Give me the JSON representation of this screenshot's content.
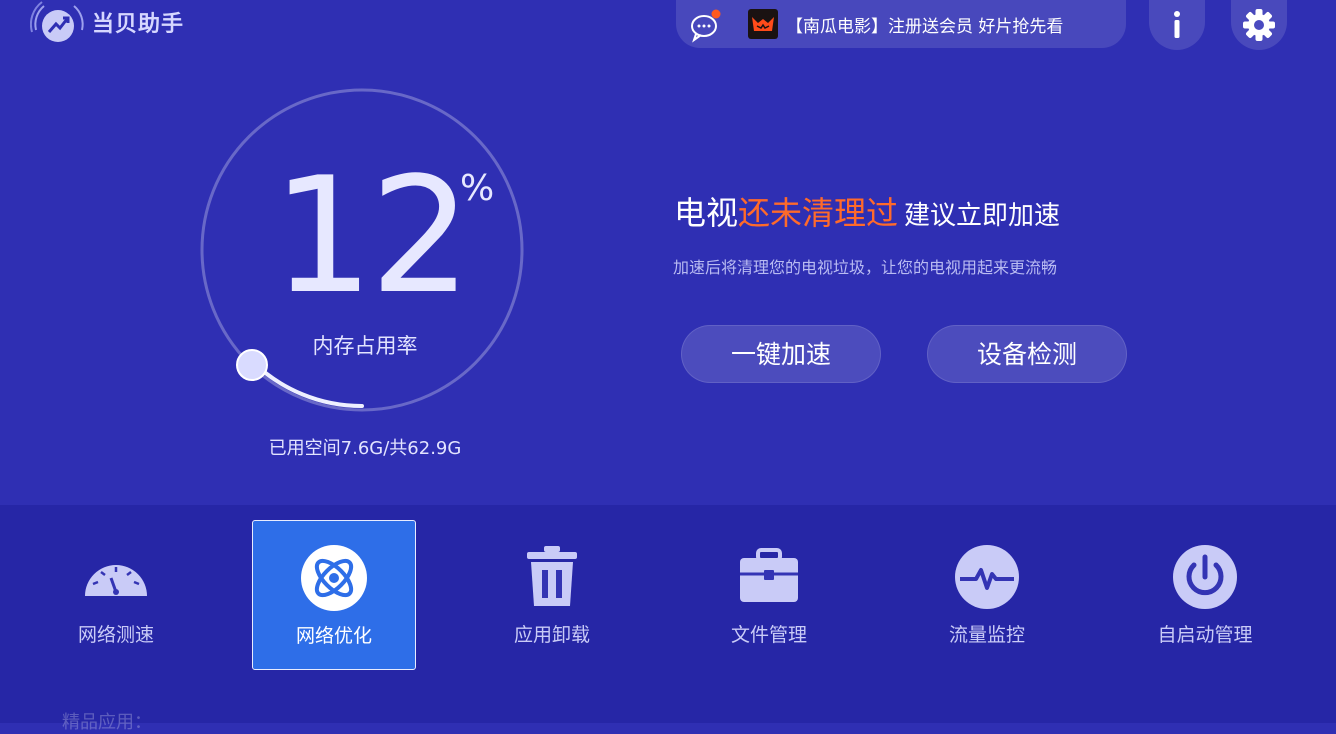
{
  "app": {
    "name": "当贝助手"
  },
  "notice": {
    "text": "【南瓜电影】注册送会员 好片抢先看"
  },
  "gauge": {
    "value": "12",
    "unit": "%",
    "label": "内存占用率",
    "usage": "已用空间7.6G/共62.9G",
    "fraction": 0.12
  },
  "message": {
    "prefix": "电视",
    "highlight": "还未清理过",
    "suffix": "建议立即加速",
    "subtitle": "加速后将清理您的电视垃圾，让您的电视用起来更流畅"
  },
  "actions": {
    "speedup": "一键加速",
    "detect": "设备检测"
  },
  "tools": [
    {
      "label": "网络测速",
      "icon": "speedometer-icon"
    },
    {
      "label": "网络优化",
      "icon": "atom-icon"
    },
    {
      "label": "应用卸载",
      "icon": "trash-icon"
    },
    {
      "label": "文件管理",
      "icon": "toolbox-icon"
    },
    {
      "label": "流量监控",
      "icon": "pulse-icon"
    },
    {
      "label": "自启动管理",
      "icon": "power-icon"
    }
  ],
  "section": {
    "title": "精品应用："
  },
  "colors": {
    "background": "#2f2fb3",
    "accent": "#ff6a2a",
    "active": "#2e6ee8"
  }
}
